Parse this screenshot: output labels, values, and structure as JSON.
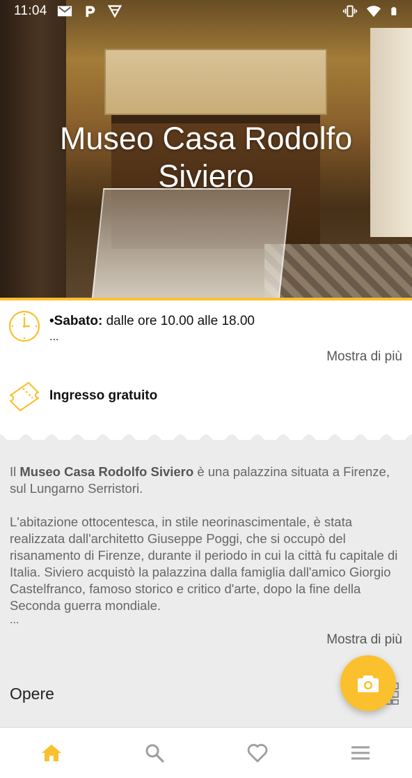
{
  "status_bar": {
    "time": "11:04",
    "left_icons": [
      "gmail-icon",
      "parking-icon",
      "play-games-icon"
    ],
    "right_icons": [
      "vibrate-icon",
      "wifi-icon",
      "battery-icon"
    ]
  },
  "hero": {
    "title": "Museo Casa Rodolfo Siviero"
  },
  "info": {
    "hours_day": "•Sabato:",
    "hours_text": " dalle ore 10.00 alle 18.00",
    "hours_ellipsis": "...",
    "hours_more": "Mostra di più",
    "admission": "Ingresso gratuito"
  },
  "description": {
    "p1_prefix": "Il ",
    "p1_bold": "Museo Casa Rodolfo Siviero",
    "p1_suffix": " è una palazzina situata a Firenze, sul Lungarno Serristori.",
    "p2": "L'abitazione ottocentesca, in stile neorinascimentale, è stata realizzata dall'architetto Giuseppe Poggi, che si occupò del risanamento di Firenze, durante il periodo in cui la città fu capitale di Italia. Siviero  acquistò la palazzina dalla famiglia dall'amico Giorgio Castelfranco, famoso storico e critico d'arte, dopo la fine della Seconda guerra mondiale.",
    "ellipsis": "...",
    "more": "Mostra di più"
  },
  "works": {
    "heading": "Opere"
  },
  "fab": {
    "icon": "camera-icon"
  },
  "bottom_nav": {
    "items": [
      "home-icon",
      "search-icon",
      "heart-icon",
      "menu-icon"
    ]
  },
  "colors": {
    "accent": "#fbc02d",
    "active_nav": "#fbc02d",
    "inactive_nav": "#9e9e9e",
    "background": "#ececec"
  }
}
